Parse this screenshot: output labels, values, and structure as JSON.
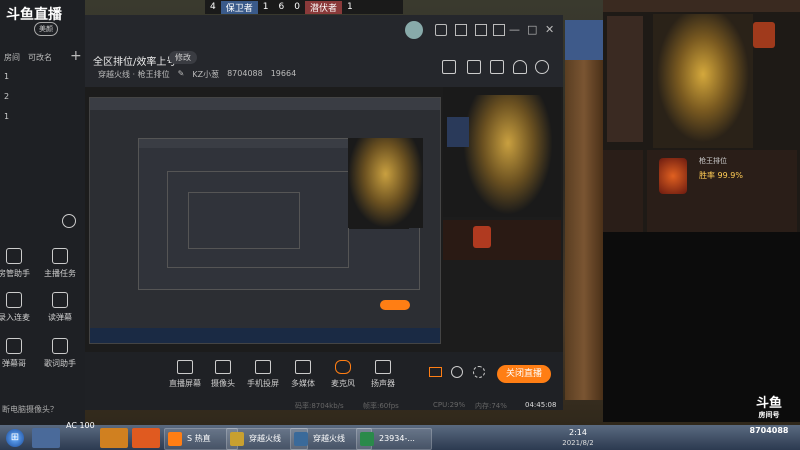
{
  "hud": {
    "left_score": "4",
    "team_defender": "保卫者",
    "mid1": "1",
    "mid2": "6",
    "right_score": "0",
    "team_attacker": "潜伏者",
    "r2": "1"
  },
  "left_panel": {
    "logo": "斗鱼直播",
    "switch_label": "美颜",
    "col_room": "房间",
    "col_alias": "可改名",
    "add": "+",
    "rows": [
      "1",
      "2",
      "1"
    ],
    "buttons": [
      {
        "label": "房管助手"
      },
      {
        "label": "主播任务"
      },
      {
        "label": "录入连麦"
      },
      {
        "label": "读弹幕"
      },
      {
        "label": "弹幕哥"
      },
      {
        "label": "歌词助手"
      }
    ],
    "footer": "断电脑摄像头？"
  },
  "window": {
    "title_controls": [
      "—",
      "□",
      "✕"
    ],
    "subtitle": "全区排位/效率上号",
    "edit_label": "修改",
    "category": "穿越火线 · 枪王排位",
    "category_edit": "✎",
    "user": "KZ小葱",
    "room_id": "8704088",
    "fans": "19664"
  },
  "toolbar": {
    "items": [
      {
        "label": "直播屏幕"
      },
      {
        "label": "摄像头"
      },
      {
        "label": "手机投屏"
      },
      {
        "label": "多媒体"
      },
      {
        "label": "麦克风"
      },
      {
        "label": "扬声器"
      }
    ],
    "close_live": "关闭直播"
  },
  "status": {
    "bitrate": "码率:8704kb/s",
    "fps": "帧率:60fps",
    "cpu": "CPU:29%",
    "mem": "内存:74%",
    "time": "04:45:08"
  },
  "right_game": {
    "rank_label": "胜率 99.9%",
    "score_label": "枪王排位",
    "douyu_logo": "斗鱼",
    "douyu_sub": "房间号",
    "douyu_id": "8704088"
  },
  "taskbar": {
    "start": "⊞",
    "items": [
      {
        "label": "S 热直"
      },
      {
        "label": "穿越火线"
      },
      {
        "label": "穿越火线"
      },
      {
        "label": "23934-..."
      }
    ],
    "clock_time": "2:14",
    "clock_date": "2021/8/2",
    "ac_label": "AC 100"
  },
  "colors": {
    "accent": "#ff7e14",
    "panel": "#24262b",
    "taskbar": "#2c3a50"
  }
}
